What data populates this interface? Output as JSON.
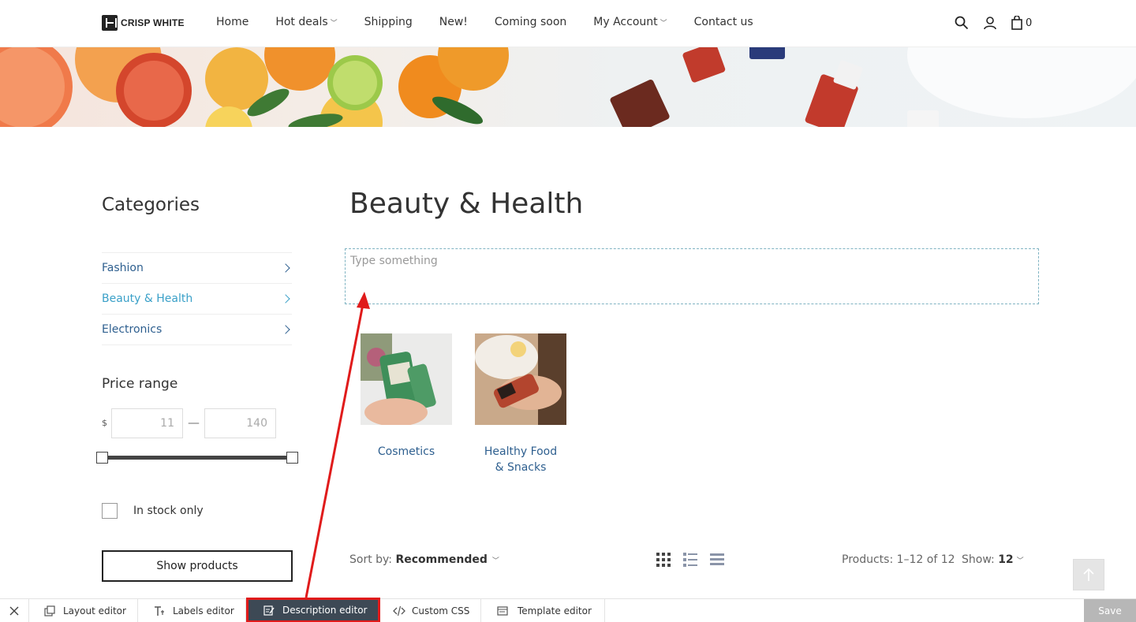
{
  "header": {
    "logo_text": "CRISP WHITE",
    "nav": [
      {
        "label": "Home",
        "dropdown": false
      },
      {
        "label": "Hot deals",
        "dropdown": true
      },
      {
        "label": "Shipping",
        "dropdown": false
      },
      {
        "label": "New!",
        "dropdown": false
      },
      {
        "label": "Coming soon",
        "dropdown": false
      },
      {
        "label": "My Account",
        "dropdown": true
      },
      {
        "label": "Contact us",
        "dropdown": false
      }
    ],
    "cart_count": "0"
  },
  "sidebar": {
    "title": "Categories",
    "categories": [
      {
        "label": "Fashion",
        "active": false
      },
      {
        "label": "Beauty & Health",
        "active": true
      },
      {
        "label": "Electronics",
        "active": false
      }
    ],
    "price": {
      "title": "Price range",
      "currency": "$",
      "min": "11",
      "max": "140",
      "dash": "—"
    },
    "in_stock_label": "In stock only",
    "show_button": "Show products"
  },
  "main": {
    "title": "Beauty & Health",
    "description_placeholder": "Type something",
    "subcategories": [
      {
        "name": "Cosmetics"
      },
      {
        "name": "Healthy Food\n& Snacks"
      }
    ],
    "sort_label": "Sort by:",
    "sort_value": "Recommended",
    "products_count": "Products: 1–12 of 12",
    "show_label": "Show:",
    "show_value": "12"
  },
  "toolbar": {
    "items": [
      {
        "label": "Layout editor",
        "icon": "layout-icon"
      },
      {
        "label": "Labels editor",
        "icon": "text-icon"
      },
      {
        "label": "Description editor",
        "icon": "edit-icon"
      },
      {
        "label": "Custom CSS",
        "icon": "code-icon"
      },
      {
        "label": "Template editor",
        "icon": "template-icon"
      }
    ],
    "save_label": "Save"
  },
  "colors": {
    "link": "#2e5f8f",
    "active_link": "#3aa0c8",
    "toolbar_active_bg": "#3d4955",
    "highlight": "#e01b1b",
    "save_bg": "#b7b7b7"
  }
}
